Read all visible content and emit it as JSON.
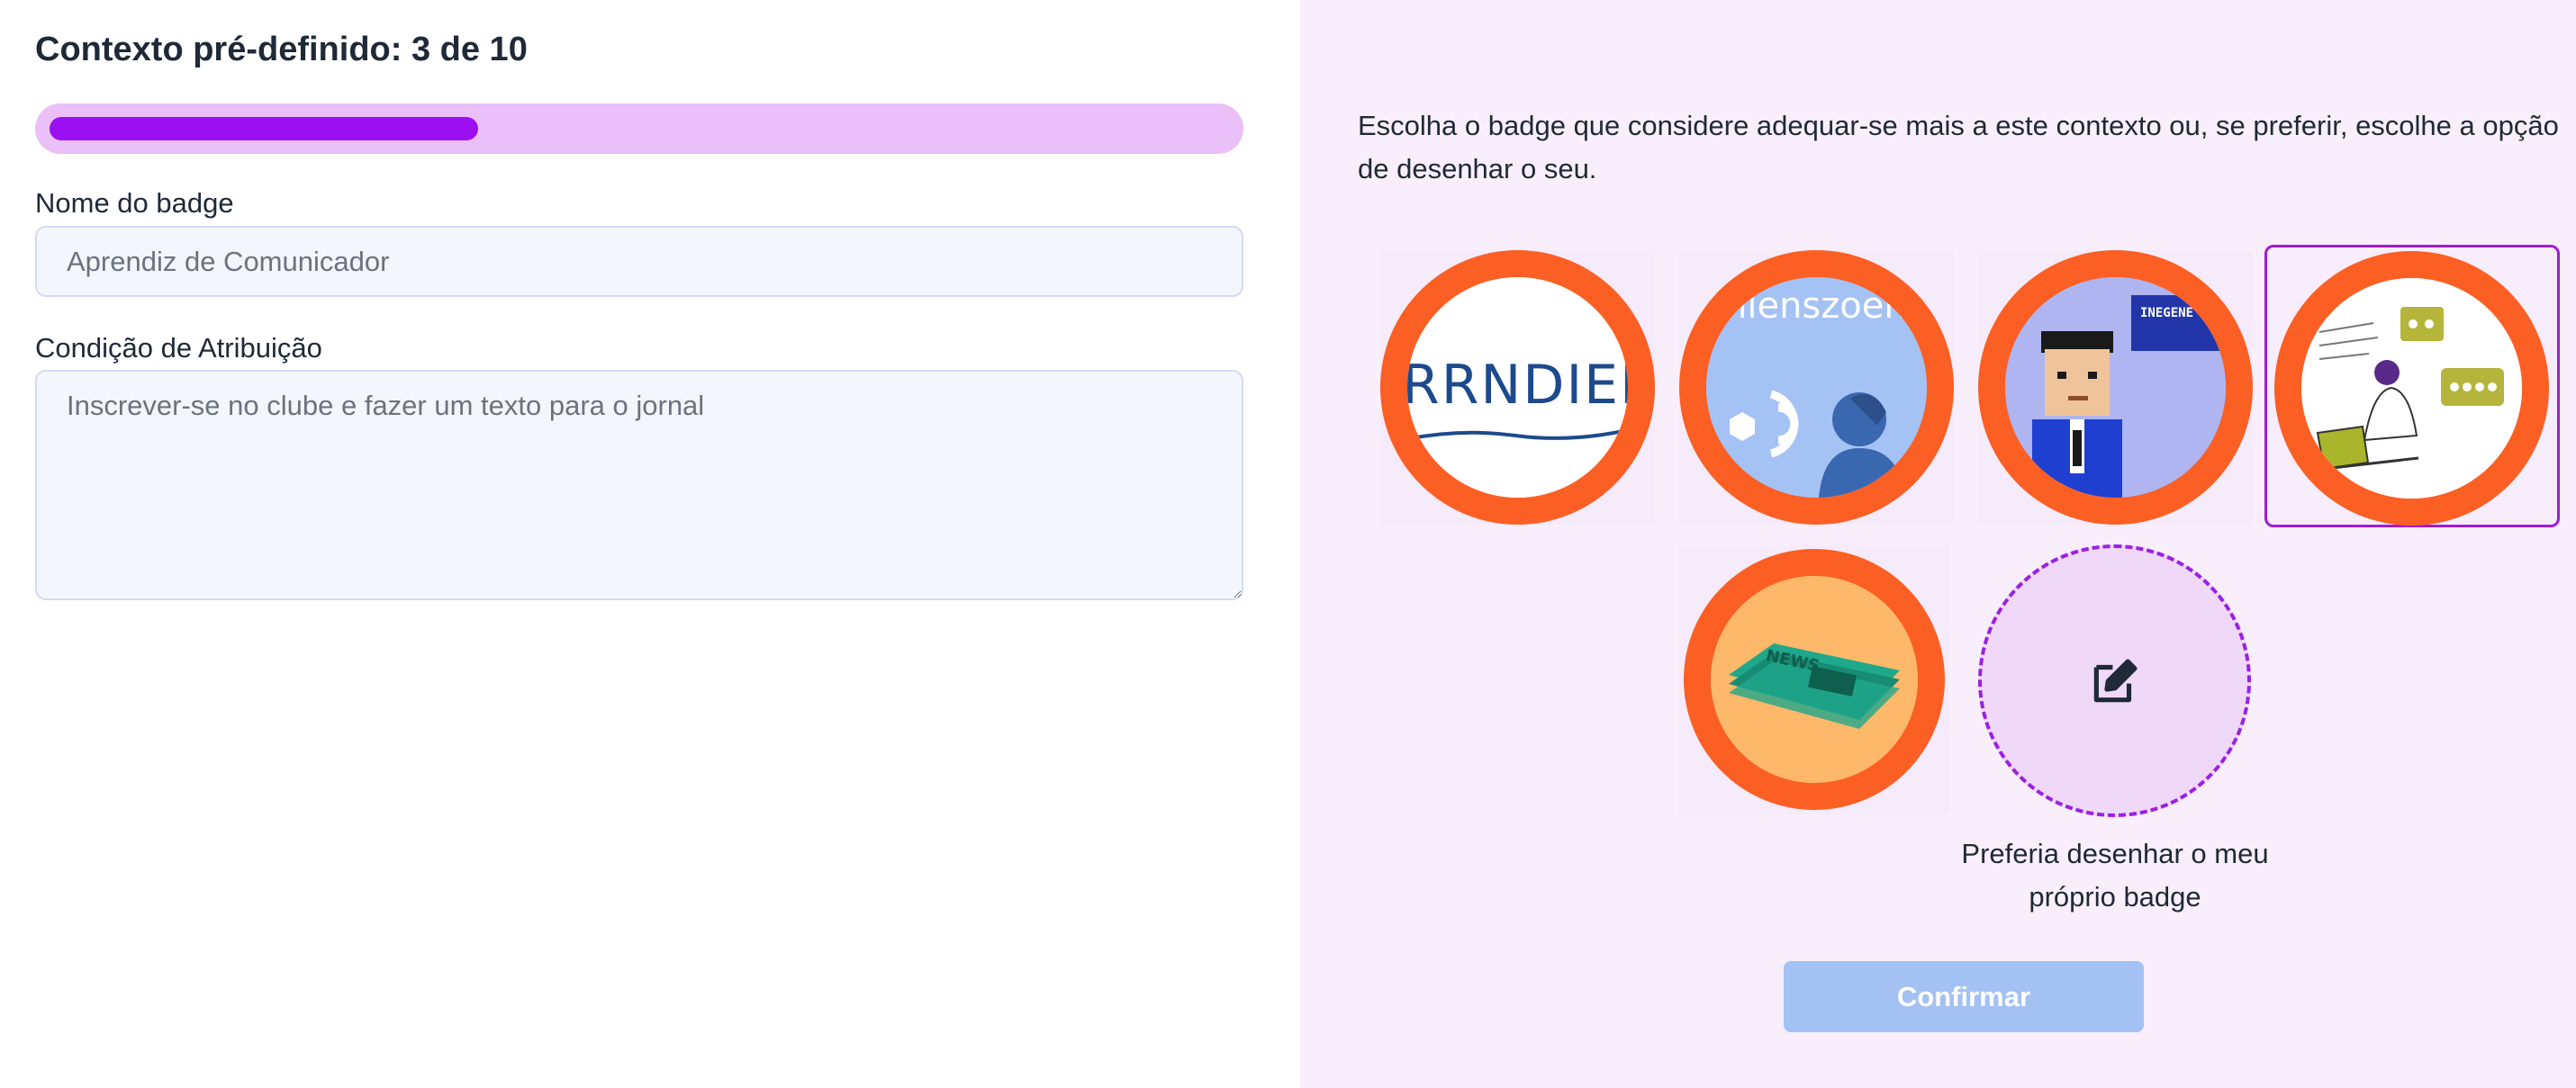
{
  "context": {
    "title": "Contexto pré-definido: 3 de 10",
    "progress_fraction": 0.3
  },
  "form": {
    "name_label": "Nome do badge",
    "name_placeholder": "Aprendiz de Comunicador",
    "condition_label": "Condição de Atribuição",
    "condition_placeholder": "Inscrever-se no clube e fazer um texto para o jornal"
  },
  "badges": {
    "instructions": "Escolha o badge que considere adequar-se mais a este contexto ou, se preferir, escolhe a opção de desenhar o seu.",
    "items": [
      {
        "id": "badge-1",
        "image_text": "RRNDIER",
        "selected": false
      },
      {
        "id": "badge-2",
        "image_text": "nlenszoen",
        "selected": false
      },
      {
        "id": "badge-3",
        "image_text": "INEGENE -LPENCE",
        "selected": false
      },
      {
        "id": "badge-4",
        "image_text": "",
        "selected": true
      },
      {
        "id": "badge-5",
        "image_text": "NEWS",
        "selected": false
      }
    ],
    "draw_own_label": "Preferia desenhar o meu próprio badge"
  },
  "actions": {
    "confirm_label": "Confirmar"
  },
  "colors": {
    "accent": "#9b0ff2",
    "progress_track": "#ebc0f8",
    "badge_ring": "#fc5f24",
    "panel_bg": "#f9effc",
    "confirm_bg": "#a3c1f3"
  },
  "icons": {
    "draw": "edit-pencil-icon"
  }
}
